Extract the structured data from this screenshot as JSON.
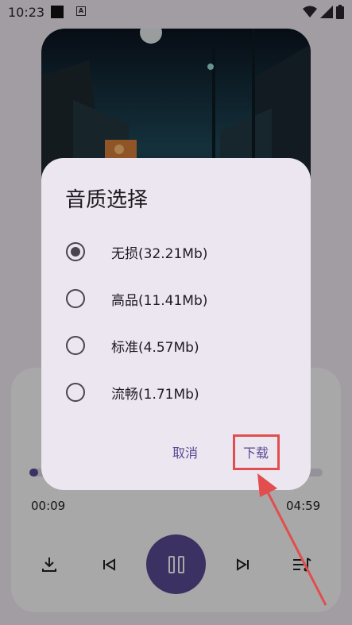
{
  "status_bar": {
    "time": "10:23",
    "notif_icon": "A"
  },
  "player": {
    "elapsed": "00:09",
    "total": "04:59",
    "progress_fraction": 0.03,
    "controls": {
      "download_icon": "download-icon",
      "prev_icon": "skip-previous-icon",
      "play_pause_icon": "pause-icon",
      "next_icon": "skip-next-icon",
      "playlist_icon": "playlist-icon"
    }
  },
  "dialog": {
    "title": "音质选择",
    "options": [
      {
        "label": "无损(32.21Mb)",
        "selected": true
      },
      {
        "label": "高品(11.41Mb)",
        "selected": false
      },
      {
        "label": "标准(4.57Mb)",
        "selected": false
      },
      {
        "label": "流畅(1.71Mb)",
        "selected": false
      }
    ],
    "cancel_label": "取消",
    "confirm_label": "下载"
  },
  "colors": {
    "accent": "#5b4b96",
    "dialog_bg": "#ece6f0",
    "annotation_red": "#e24d4d"
  }
}
